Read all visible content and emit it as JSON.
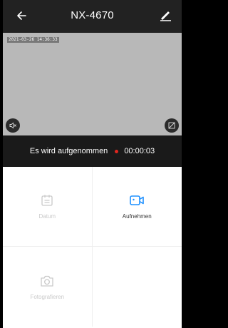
{
  "header": {
    "title": "NX-4670"
  },
  "video": {
    "osd_text": "2021-03-26 14:36:33"
  },
  "recording": {
    "status_text": "Es wird aufgenommen",
    "timer": "00:00:03"
  },
  "actions": [
    {
      "label": "Datum",
      "icon": "calendar-icon",
      "enabled": false
    },
    {
      "label": "Aufnehmen",
      "icon": "video-camera-icon",
      "enabled": true
    },
    {
      "label": "Fotografieren",
      "icon": "camera-icon",
      "enabled": false
    }
  ],
  "colors": {
    "accent": "#1e90ff",
    "record_dot": "#e0261f",
    "topbar": "#222222",
    "disabled": "#c9c9c9"
  }
}
